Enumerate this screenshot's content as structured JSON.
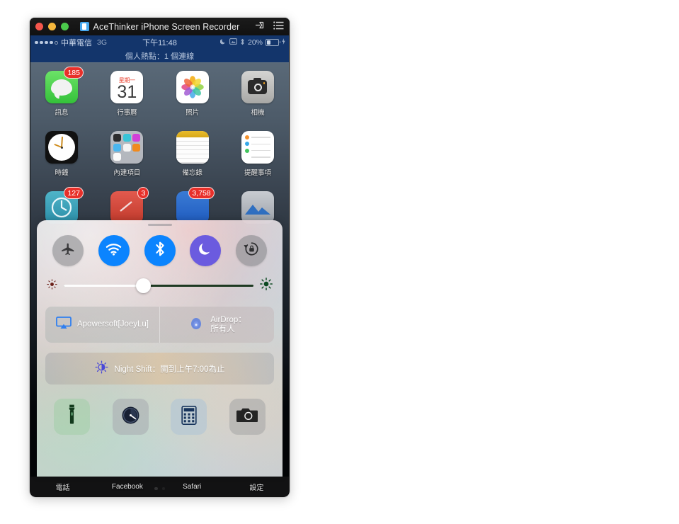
{
  "window": {
    "title": "AceThinker iPhone Screen Recorder",
    "app_icon": "app-icon",
    "traffic_lights": [
      "close",
      "minimize",
      "maximize"
    ],
    "pin_icon": "pin-icon",
    "menu_icon": "list-menu-icon"
  },
  "status_bar": {
    "signal_dots_filled": 4,
    "signal_dots_total": 5,
    "carrier": "中華電信",
    "network": "3G",
    "time": "下午11:48",
    "dnd_icon": "moon-icon",
    "rotation_icon": "rotation-lock-icon",
    "bluetooth_icon": "bluetooth-icon",
    "battery_percent": "20%",
    "charging_icon": "lightning-bolt-icon"
  },
  "hotspot": {
    "text": "個人熱點：1 個連線"
  },
  "home_screen": {
    "rows": [
      [
        {
          "label": "訊息",
          "icon": "messages-icon",
          "badge": "185"
        },
        {
          "label": "行事曆",
          "icon": "calendar-icon",
          "weekday": "星期一",
          "day": "31"
        },
        {
          "label": "照片",
          "icon": "photos-icon"
        },
        {
          "label": "相機",
          "icon": "camera-icon"
        }
      ],
      [
        {
          "label": "時鐘",
          "icon": "clock-icon"
        },
        {
          "label": "內建項目",
          "icon": "folder-icon"
        },
        {
          "label": "備忘錄",
          "icon": "notes-icon"
        },
        {
          "label": "提醒事項",
          "icon": "reminders-icon"
        }
      ],
      [
        {
          "label": "",
          "icon": "app-teal-icon",
          "badge": "127"
        },
        {
          "label": "",
          "icon": "app-red-icon",
          "badge": "3"
        },
        {
          "label": "",
          "icon": "app-blue-icon",
          "badge": "3,758"
        },
        {
          "label": "",
          "icon": "app-gray-icon"
        }
      ]
    ]
  },
  "control_center": {
    "toggles": [
      {
        "name": "airplane-mode",
        "icon": "airplane-icon",
        "state": "off"
      },
      {
        "name": "wifi",
        "icon": "wifi-icon",
        "state": "on"
      },
      {
        "name": "bluetooth",
        "icon": "bluetooth-icon",
        "state": "on"
      },
      {
        "name": "do-not-disturb",
        "icon": "moon-icon",
        "state": "on"
      },
      {
        "name": "rotation-lock",
        "icon": "rotation-lock-icon",
        "state": "off"
      }
    ],
    "brightness": {
      "value_percent": 42,
      "low_icon": "sun-small-icon",
      "high_icon": "sun-large-icon"
    },
    "airplay": {
      "icon": "airplay-icon",
      "label": "Apowersoft[JoeyLu]"
    },
    "airdrop": {
      "icon": "airdrop-icon",
      "line1": "AirDrop：",
      "line2": "所有人"
    },
    "night_shift": {
      "icon": "night-shift-icon",
      "label": "Night Shift：開到上午7:00為止"
    },
    "shortcuts": [
      {
        "name": "flashlight",
        "icon": "flashlight-icon"
      },
      {
        "name": "timer",
        "icon": "timer-icon"
      },
      {
        "name": "calculator",
        "icon": "calculator-icon"
      },
      {
        "name": "camera",
        "icon": "camera-icon"
      }
    ]
  },
  "dock": {
    "items": [
      {
        "label": "電話"
      },
      {
        "label": "Facebook"
      },
      {
        "label": "Safari"
      },
      {
        "label": "設定"
      }
    ],
    "page_dots": 2,
    "active_dot": 0
  },
  "colors": {
    "accent_blue": "#0b84fe",
    "accent_purple": "#6b5bdf",
    "badge_red": "#e8302a",
    "status_bar_blue": "#13356b",
    "titlebar_dark": "#141414"
  }
}
